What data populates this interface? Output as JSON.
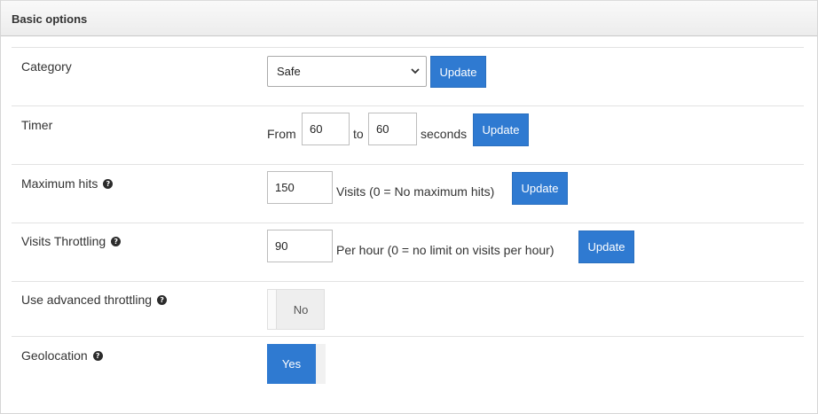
{
  "panel": {
    "title": "Basic options"
  },
  "category": {
    "label": "Category",
    "selected": "Safe",
    "update": "Update"
  },
  "timer": {
    "label": "Timer",
    "from_text": "From",
    "from_value": "60",
    "to_text": "to",
    "to_value": "60",
    "unit_text": "seconds",
    "update": "Update"
  },
  "max_hits": {
    "label": "Maximum hits",
    "value": "150",
    "hint": "Visits (0 = No maximum hits)",
    "update": "Update"
  },
  "visits_throttling": {
    "label": "Visits Throttling",
    "value": "90",
    "hint": "Per hour (0 = no limit on visits per hour)",
    "update": "Update"
  },
  "advanced_throttling": {
    "label": "Use advanced throttling",
    "state": "No"
  },
  "geolocation": {
    "label": "Geolocation",
    "state": "Yes"
  },
  "icons": {
    "help": "question-circle-icon",
    "select_arrow": "chevron-down-icon"
  },
  "colors": {
    "primary_button": "#2f7ad1",
    "header_background": "#efefef"
  }
}
